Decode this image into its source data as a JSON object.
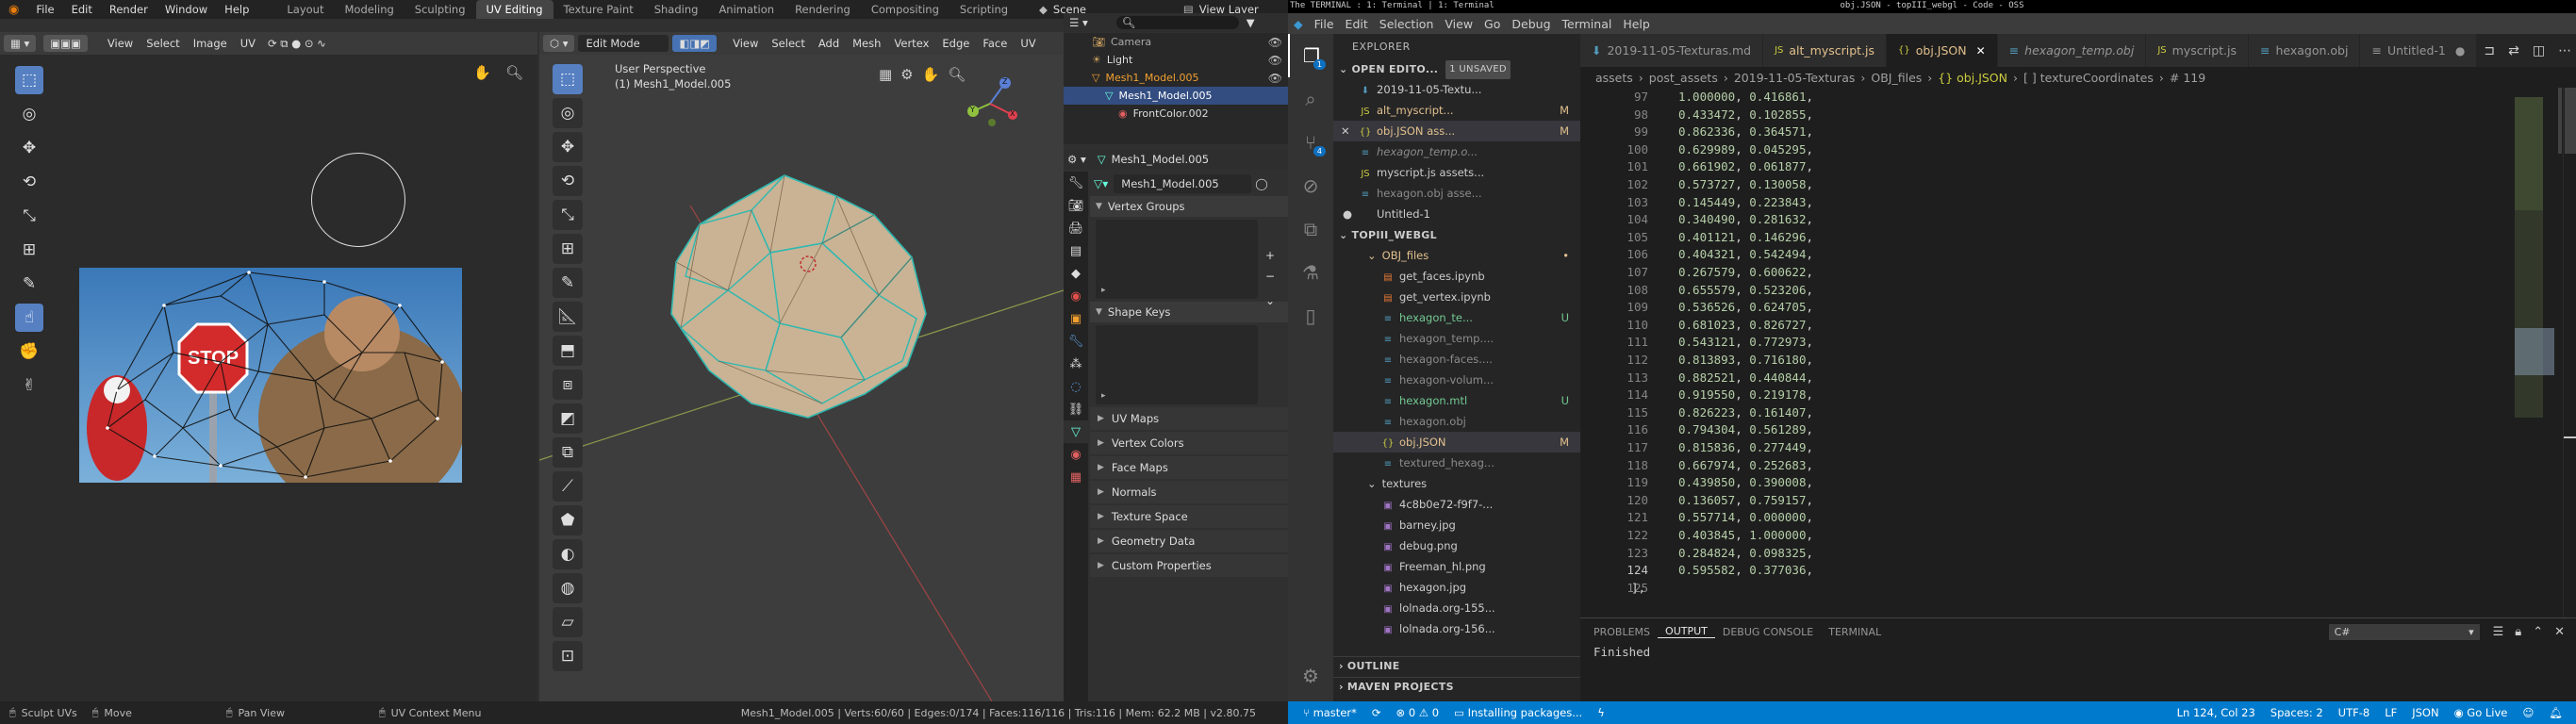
{
  "blender": {
    "topbar": {
      "menus": [
        "File",
        "Edit",
        "Render",
        "Window",
        "Help"
      ],
      "workspaces": [
        "Layout",
        "Modeling",
        "Sculpting",
        "UV Editing",
        "Texture Paint",
        "Shading",
        "Animation",
        "Rendering",
        "Compositing",
        "Scripting"
      ],
      "scene": "Scene",
      "view_layer": "View Layer"
    },
    "uv_header": {
      "menus": [
        "View",
        "Select",
        "Image",
        "UV"
      ]
    },
    "v3d_header": {
      "mode": "Edit Mode",
      "menus": [
        "View",
        "Select",
        "Add",
        "Mesh",
        "Vertex",
        "Edge",
        "Face",
        "UV"
      ]
    },
    "v3d_overlay": {
      "perspective": "User Perspective",
      "object": "(1) Mesh1_Model.005"
    },
    "uv_image": {
      "sign_text": "STOP"
    },
    "gizmo": {
      "x": "X",
      "y": "Y",
      "z": "Z"
    },
    "outliner": {
      "rows": [
        {
          "label": "Camera"
        },
        {
          "label": "Light"
        },
        {
          "label": "Mesh1_Model.005"
        },
        {
          "label": "Mesh1_Model.005"
        },
        {
          "label": "FrontColor.002"
        }
      ]
    },
    "properties": {
      "object_name": "Mesh1_Model.005",
      "mesh_name": "Mesh1_Model.005",
      "panels": [
        "Vertex Groups",
        "Shape Keys"
      ],
      "collapsed": [
        "UV Maps",
        "Vertex Colors",
        "Face Maps",
        "Normals",
        "Texture Space",
        "Geometry Data",
        "Custom Properties"
      ]
    },
    "status": {
      "left": "Sculpt UVs",
      "move": "Move",
      "pan": "Pan View",
      "ctx": "UV Context Menu",
      "stats": "Mesh1_Model.005 | Verts:60/60 | Edges:0/174 | Faces:116/116 | Tris:116 | Mem: 62.2 MB | v2.80.75"
    }
  },
  "vscode": {
    "os_title": "obj.JSON - topIII_webgl - Code - OSS",
    "os_left": "The TERMINAL : 1: Terminal | 1: Terminal",
    "menus": [
      "File",
      "Edit",
      "Selection",
      "View",
      "Go",
      "Debug",
      "Terminal",
      "Help"
    ],
    "explorer_title": "EXPLORER",
    "open_editors": {
      "label": "OPEN EDITO...",
      "badge": "1 UNSAVED",
      "items": [
        {
          "label": "2019-11-05-Textu...",
          "status": ""
        },
        {
          "label": "alt_myscript...",
          "status": "M"
        },
        {
          "label": "obj.JSON ass...",
          "status": "M"
        },
        {
          "label": "hexagon_temp.o...",
          "status": ""
        },
        {
          "label": "myscript.js assets...",
          "status": ""
        },
        {
          "label": "hexagon.obj asse...",
          "status": ""
        },
        {
          "label": "Untitled-1",
          "status": ""
        }
      ]
    },
    "project": {
      "label": "TOPIII_WEBGL",
      "items": [
        {
          "label": "OBJ_files",
          "status": "•"
        },
        {
          "label": "get_faces.ipynb",
          "status": ""
        },
        {
          "label": "get_vertex.ipynb",
          "status": ""
        },
        {
          "label": "hexagon_te...",
          "status": "U"
        },
        {
          "label": "hexagon_temp....",
          "status": ""
        },
        {
          "label": "hexagon-faces....",
          "status": ""
        },
        {
          "label": "hexagon-volum...",
          "status": ""
        },
        {
          "label": "hexagon.mtl",
          "status": "U"
        },
        {
          "label": "hexagon.obj",
          "status": ""
        },
        {
          "label": "obj.JSON",
          "status": "M"
        },
        {
          "label": "textured_hexag...",
          "status": ""
        },
        {
          "label": "textures",
          "status": ""
        },
        {
          "label": "4c8b0e72-f9f7-...",
          "status": ""
        },
        {
          "label": "barney.jpg",
          "status": ""
        },
        {
          "label": "debug.png",
          "status": ""
        },
        {
          "label": "Freeman_hl.png",
          "status": ""
        },
        {
          "label": "hexagon.jpg",
          "status": ""
        },
        {
          "label": "lolnada.org-155...",
          "status": ""
        },
        {
          "label": "lolnada.org-156...",
          "status": ""
        }
      ]
    },
    "outline_label": "OUTLINE",
    "maven_label": "MAVEN PROJECTS",
    "tabs": [
      "2019-11-05-Texturas.md",
      "alt_myscript.js",
      "obj.JSON",
      "hexagon_temp.obj",
      "myscript.js",
      "hexagon.obj",
      "Untitled-1"
    ],
    "breadcrumb": [
      "assets",
      "post_assets",
      "2019-11-05-Texturas",
      "OBJ_files",
      "{} obj.JSON",
      "[ ] textureCoordinates",
      "# 119"
    ],
    "code_lines": [
      {
        "n": "97",
        "a": "1.000000",
        "b": "0.416861"
      },
      {
        "n": "98",
        "a": "0.433472",
        "b": "0.102855"
      },
      {
        "n": "99",
        "a": "0.862336",
        "b": "0.364571"
      },
      {
        "n": "100",
        "a": "0.629989",
        "b": "0.045295"
      },
      {
        "n": "101",
        "a": "0.661902",
        "b": "0.061877"
      },
      {
        "n": "102",
        "a": "0.573727",
        "b": "0.130058"
      },
      {
        "n": "103",
        "a": "0.145449",
        "b": "0.223843"
      },
      {
        "n": "104",
        "a": "0.340490",
        "b": "0.281632"
      },
      {
        "n": "105",
        "a": "0.401121",
        "b": "0.146296"
      },
      {
        "n": "106",
        "a": "0.404321",
        "b": "0.542494"
      },
      {
        "n": "107",
        "a": "0.267579",
        "b": "0.600622"
      },
      {
        "n": "108",
        "a": "0.655579",
        "b": "0.523206"
      },
      {
        "n": "109",
        "a": "0.536526",
        "b": "0.624705"
      },
      {
        "n": "110",
        "a": "0.681023",
        "b": "0.826727"
      },
      {
        "n": "111",
        "a": "0.543121",
        "b": "0.772973"
      },
      {
        "n": "112",
        "a": "0.813893",
        "b": "0.716180"
      },
      {
        "n": "113",
        "a": "0.882521",
        "b": "0.440844"
      },
      {
        "n": "114",
        "a": "0.919550",
        "b": "0.219178"
      },
      {
        "n": "115",
        "a": "0.826223",
        "b": "0.161407"
      },
      {
        "n": "116",
        "a": "0.794304",
        "b": "0.561289"
      },
      {
        "n": "117",
        "a": "0.815836",
        "b": "0.277449"
      },
      {
        "n": "118",
        "a": "0.667974",
        "b": "0.252683"
      },
      {
        "n": "119",
        "a": "0.439850",
        "b": "0.390008"
      },
      {
        "n": "120",
        "a": "0.136057",
        "b": "0.759157"
      },
      {
        "n": "121",
        "a": "0.557714",
        "b": "0.000000"
      },
      {
        "n": "122",
        "a": "0.403845",
        "b": "1.000000"
      },
      {
        "n": "123",
        "a": "0.284824",
        "b": "0.098325"
      },
      {
        "n": "124",
        "a": "0.595582",
        "b": "0.377036"
      },
      {
        "n": "125",
        "a": "",
        "b": ""
      }
    ],
    "closing_bracket": "],",
    "panel": {
      "tabs": [
        "PROBLEMS",
        "OUTPUT",
        "DEBUG CONSOLE",
        "TERMINAL"
      ],
      "active": "OUTPUT",
      "lang": "C#",
      "output": "Finished"
    },
    "status": {
      "branch": "master*",
      "errors": "0",
      "warnings": "0",
      "installing": "Installing packages...",
      "position": "Ln 124, Col 23",
      "spaces": "Spaces: 2",
      "encoding": "UTF-8",
      "eol": "LF",
      "language": "JSON",
      "golive": "Go Live"
    },
    "colors": {
      "accent": "#007acc",
      "statusbar": "#007acc"
    }
  }
}
